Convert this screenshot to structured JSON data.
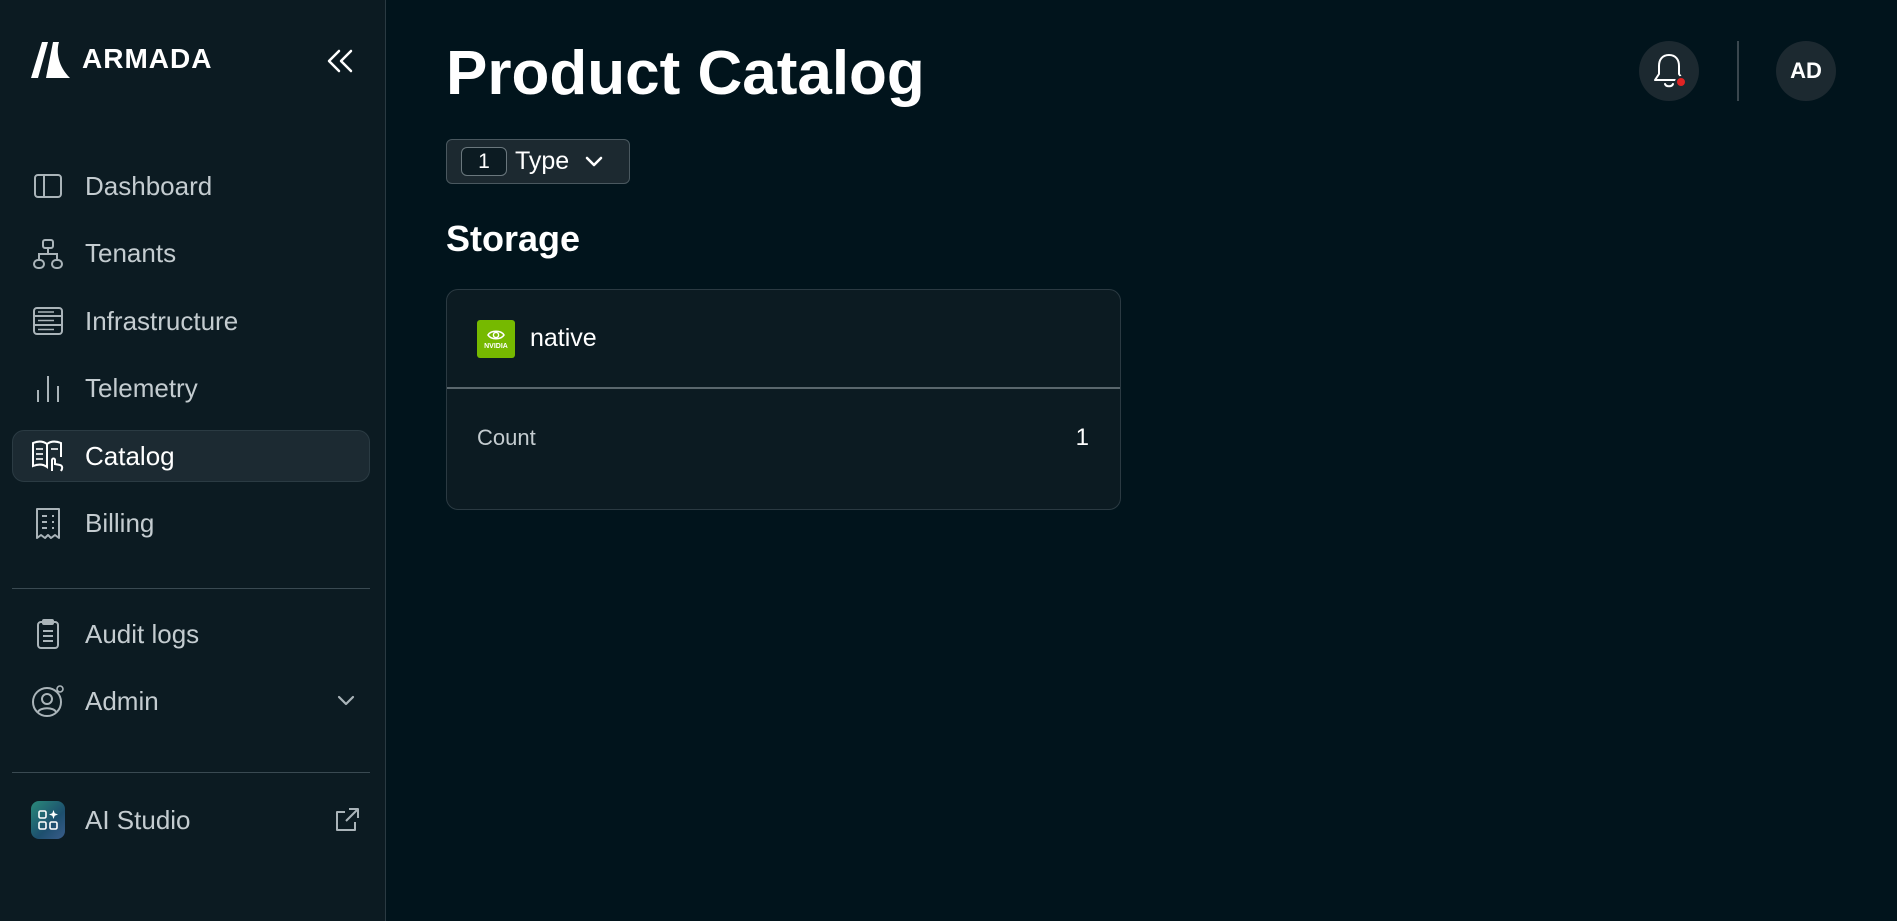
{
  "brand": {
    "name": "ARMADA"
  },
  "sidebar": {
    "items": [
      {
        "label": "Dashboard",
        "icon": "sidebar-panel-icon"
      },
      {
        "label": "Tenants",
        "icon": "org-chart-icon"
      },
      {
        "label": "Infrastructure",
        "icon": "server-rack-icon"
      },
      {
        "label": "Telemetry",
        "icon": "bar-chart-icon"
      },
      {
        "label": "Catalog",
        "icon": "book-touch-icon",
        "active": true
      },
      {
        "label": "Billing",
        "icon": "receipt-icon"
      }
    ],
    "secondary": [
      {
        "label": "Audit logs",
        "icon": "clipboard-icon"
      },
      {
        "label": "Admin",
        "icon": "user-gear-icon"
      }
    ],
    "external": {
      "label": "AI Studio",
      "icon": "ai-studio-icon"
    }
  },
  "header": {
    "title": "Product Catalog",
    "avatar_initials": "AD"
  },
  "filter": {
    "count": "1",
    "label": "Type"
  },
  "section": {
    "title": "Storage",
    "card": {
      "vendor_logo_text": "NVIDIA",
      "name": "native",
      "row_label": "Count",
      "row_value": "1"
    }
  },
  "colors": {
    "background": "#01141c",
    "sidebar": "#0c1b22",
    "active_item": "#1c2a32",
    "notification_dot": "#e02424",
    "vendor_green": "#76b900"
  }
}
